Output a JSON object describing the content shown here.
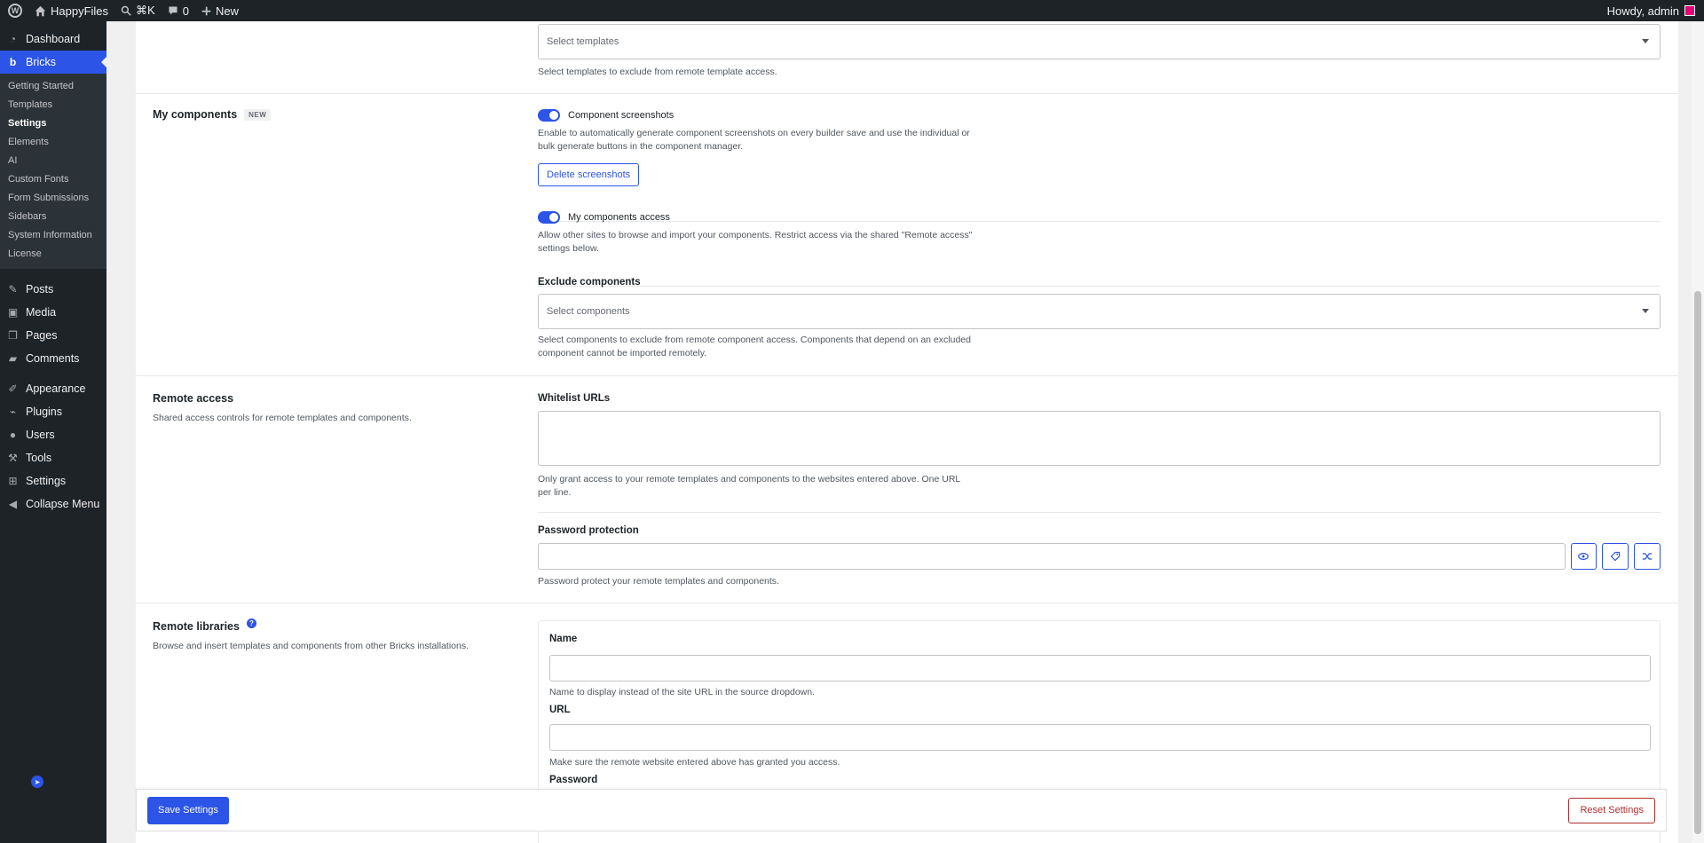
{
  "adminbar": {
    "site_name": "HappyFiles",
    "search_shortcut": "⌘K",
    "comments_count": "0",
    "new_label": "New",
    "howdy": "Howdy, admin"
  },
  "sidebar": {
    "dashboard": "Dashboard",
    "bricks": "Bricks",
    "bricks_sub": [
      "Getting Started",
      "Templates",
      "Settings",
      "Elements",
      "AI",
      "Custom Fonts",
      "Form Submissions",
      "Sidebars",
      "System Information",
      "License"
    ],
    "posts": "Posts",
    "media": "Media",
    "pages": "Pages",
    "comments": "Comments",
    "appearance": "Appearance",
    "plugins": "Plugins",
    "users": "Users",
    "tools": "Tools",
    "settings": "Settings",
    "collapse": "Collapse Menu"
  },
  "templates_section": {
    "placeholder": "Select templates",
    "help": "Select templates to exclude from remote template access."
  },
  "my_components": {
    "title": "My components",
    "badge": "NEW",
    "screenshots_toggle": "Component screenshots",
    "screenshots_help": "Enable to automatically generate component screenshots on every builder save and use the individual or bulk generate buttons in the component manager.",
    "delete_button": "Delete screenshots",
    "access_toggle": "My components access",
    "access_help": "Allow other sites to browse and import your components. Restrict access via the shared \"Remote access\" settings below.",
    "exclude_label": "Exclude components",
    "exclude_placeholder": "Select components",
    "exclude_help": "Select components to exclude from remote component access. Components that depend on an excluded component cannot be imported remotely."
  },
  "remote_access": {
    "title": "Remote access",
    "description": "Shared access controls for remote templates and components.",
    "whitelist_label": "Whitelist URLs",
    "whitelist_help": "Only grant access to your remote templates and components to the websites entered above. One URL per line.",
    "password_label": "Password protection",
    "password_help": "Password protect your remote templates and components."
  },
  "remote_libraries": {
    "title": "Remote libraries",
    "description": "Browse and insert templates and components from other Bricks installations.",
    "name_label": "Name",
    "name_help": "Name to display instead of the site URL in the source dropdown.",
    "url_label": "URL",
    "url_help": "Make sure the remote website entered above has granted you access.",
    "password_label": "Password"
  },
  "footer": {
    "save": "Save Settings",
    "reset": "Reset Settings"
  }
}
